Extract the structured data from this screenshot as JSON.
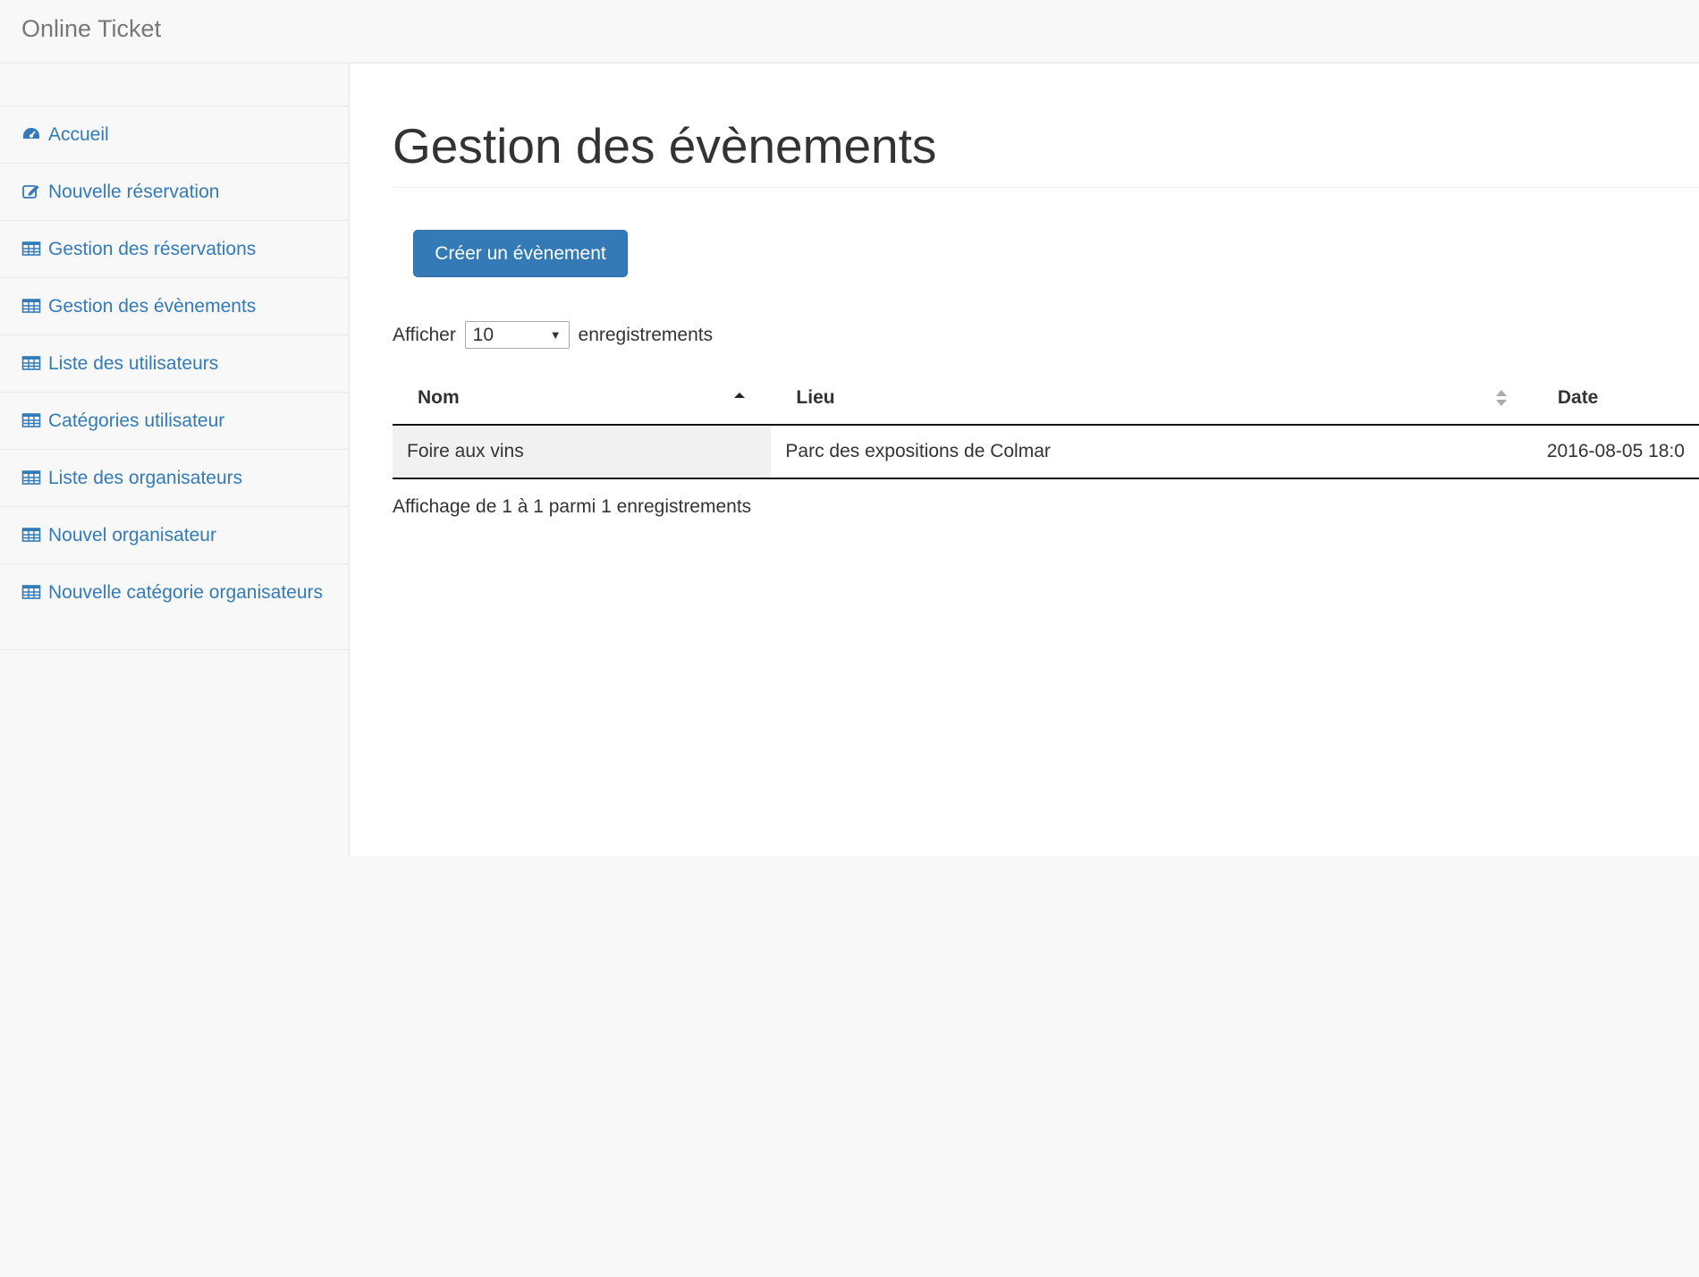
{
  "navbar": {
    "brand": "Online Ticket"
  },
  "sidebar": {
    "items": [
      {
        "label": "Accueil",
        "icon": "dashboard-icon"
      },
      {
        "label": "Nouvelle réservation",
        "icon": "edit-icon"
      },
      {
        "label": "Gestion des réservations",
        "icon": "table-icon"
      },
      {
        "label": "Gestion des évènements",
        "icon": "table-icon"
      },
      {
        "label": "Liste des utilisateurs",
        "icon": "table-icon"
      },
      {
        "label": "Catégories utilisateur",
        "icon": "table-icon"
      },
      {
        "label": "Liste des organisateurs",
        "icon": "table-icon"
      },
      {
        "label": "Nouvel organisateur",
        "icon": "table-icon"
      },
      {
        "label": "Nouvelle catégorie organisateurs",
        "icon": "table-icon"
      }
    ]
  },
  "main": {
    "title": "Gestion des évènements",
    "create_button": "Créer un évènement",
    "length": {
      "prefix": "Afficher",
      "value": "10",
      "suffix": "enregistrements"
    },
    "table": {
      "columns": [
        "Nom",
        "Lieu",
        "Date"
      ],
      "rows": [
        [
          "Foire aux vins",
          "Parc des expositions de Colmar",
          "2016-08-05 18:0"
        ]
      ]
    },
    "info": "Affichage de 1 à 1 parmi 1 enregistrements"
  },
  "colors": {
    "accent": "#337ab7",
    "link": "#337ab7",
    "background": "#f8f8f8"
  }
}
